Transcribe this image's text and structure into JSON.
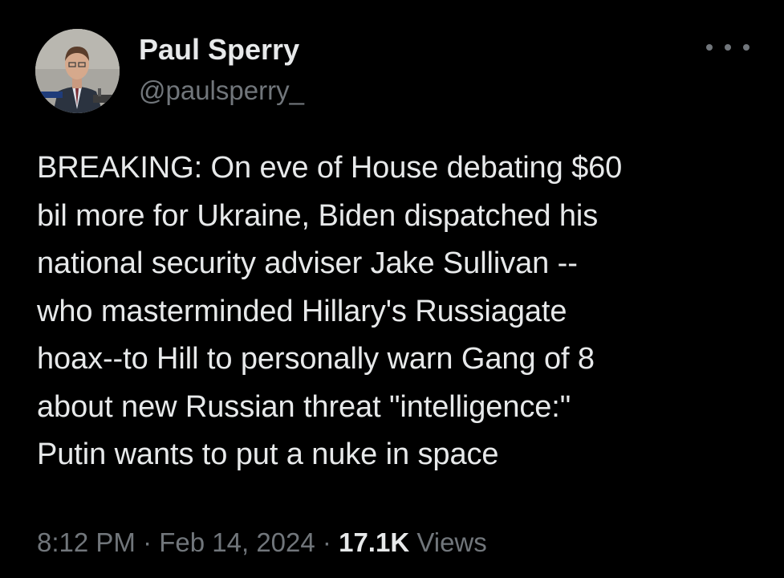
{
  "author": {
    "name": "Paul Sperry",
    "handle": "@paulsperry_",
    "avatar_icon": "profile-photo"
  },
  "tweet": {
    "text": "BREAKING: On eve of House debating $60\nbil more for Ukraine, Biden dispatched his\nnational security adviser Jake Sullivan --\nwho masterminded Hillary's Russiagate\nhoax--to Hill to personally warn Gang of 8\nabout new Russian threat \"intelligence:\"\nPutin wants to put a nuke in space",
    "time": "8:12 PM",
    "separator": "·",
    "date": "Feb 14, 2024",
    "views_count": "17.1K",
    "views_label": "Views"
  },
  "menu": {
    "more_icon": "more-horizontal-icon"
  },
  "colors": {
    "background": "#000000",
    "primary_text": "#e7e9ea",
    "secondary_text": "#71767b"
  }
}
